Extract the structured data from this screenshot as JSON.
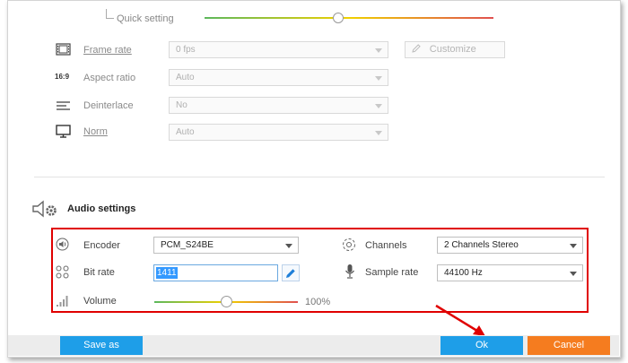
{
  "video": {
    "quick_setting_label": "Quick setting",
    "rows": [
      {
        "label": "Frame rate",
        "value": "0 fps"
      },
      {
        "label": "Aspect ratio",
        "value": "Auto"
      },
      {
        "label": "Deinterlace",
        "value": "No"
      },
      {
        "label": "Norm",
        "value": "Auto"
      }
    ],
    "customize_label": "Customize",
    "aspect_icon_text": "16:9"
  },
  "audio": {
    "section_title": "Audio settings",
    "encoder_label": "Encoder",
    "encoder_value": "PCM_S24BE",
    "bitrate_label": "Bit rate",
    "bitrate_value": "1411",
    "volume_label": "Volume",
    "volume_value": "100%",
    "volume_level": 0.5,
    "channels_label": "Channels",
    "channels_value": "2 Channels Stereo",
    "samplerate_label": "Sample rate",
    "samplerate_value": "44100 Hz"
  },
  "footer": {
    "save_as_label": "Save as",
    "ok_label": "Ok",
    "cancel_label": "Cancel"
  },
  "colors": {
    "blue_button": "#1e9ee8",
    "orange_button": "#f57c1f",
    "highlight_red": "#e00000"
  }
}
